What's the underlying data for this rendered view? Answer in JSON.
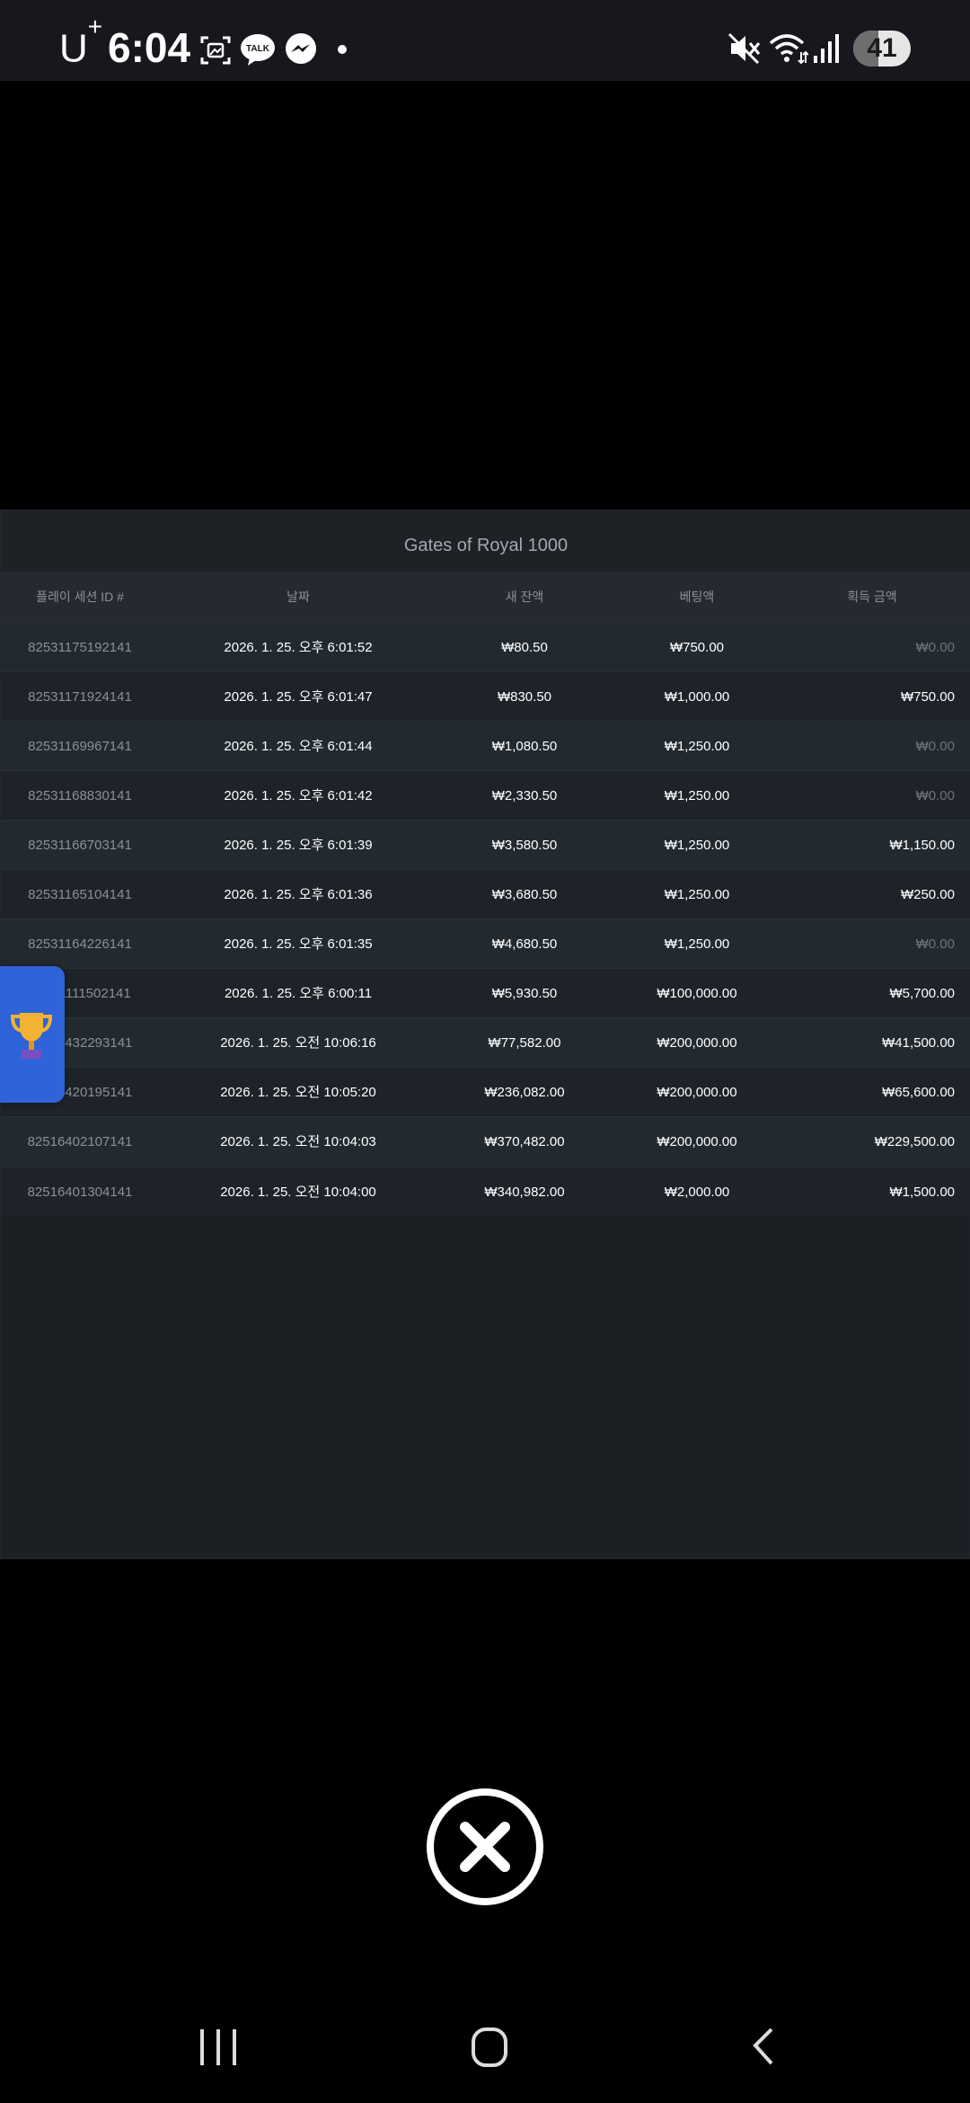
{
  "status_bar": {
    "carrier": "U",
    "carrier_sup": "+",
    "time": "6:04",
    "battery": "41",
    "icons": [
      "screenshot-icon",
      "kakaotalk-icon",
      "messenger-icon",
      "dot-icon",
      "mute-icon",
      "wifi-icon",
      "signal-icon",
      "battery-icon"
    ],
    "kakao_label": "TALK"
  },
  "panel": {
    "title": "Gates of Royal 1000",
    "columns": [
      "플레이 세션 ID #",
      "날짜",
      "새 잔액",
      "베팅액",
      "획득 금액"
    ],
    "rows": [
      {
        "id": "82531175192141",
        "date": "2026. 1. 25. 오후 6:01:52",
        "balance": "₩80.50",
        "bet": "₩750.00",
        "win": "₩0.00"
      },
      {
        "id": "82531171924141",
        "date": "2026. 1. 25. 오후 6:01:47",
        "balance": "₩830.50",
        "bet": "₩1,000.00",
        "win": "₩750.00"
      },
      {
        "id": "82531169967141",
        "date": "2026. 1. 25. 오후 6:01:44",
        "balance": "₩1,080.50",
        "bet": "₩1,250.00",
        "win": "₩0.00"
      },
      {
        "id": "82531168830141",
        "date": "2026. 1. 25. 오후 6:01:42",
        "balance": "₩2,330.50",
        "bet": "₩1,250.00",
        "win": "₩0.00"
      },
      {
        "id": "82531166703141",
        "date": "2026. 1. 25. 오후 6:01:39",
        "balance": "₩3,580.50",
        "bet": "₩1,250.00",
        "win": "₩1,150.00"
      },
      {
        "id": "82531165104141",
        "date": "2026. 1. 25. 오후 6:01:36",
        "balance": "₩3,680.50",
        "bet": "₩1,250.00",
        "win": "₩250.00"
      },
      {
        "id": "82531164226141",
        "date": "2026. 1. 25. 오후 6:01:35",
        "balance": "₩4,680.50",
        "bet": "₩1,250.00",
        "win": "₩0.00"
      },
      {
        "id": "82531111502141",
        "date": "2026. 1. 25. 오후 6:00:11",
        "balance": "₩5,930.50",
        "bet": "₩100,000.00",
        "win": "₩5,700.00"
      },
      {
        "id": "82516432293141",
        "date": "2026. 1. 25. 오전 10:06:16",
        "balance": "₩77,582.00",
        "bet": "₩200,000.00",
        "win": "₩41,500.00"
      },
      {
        "id": "82516420195141",
        "date": "2026. 1. 25. 오전 10:05:20",
        "balance": "₩236,082.00",
        "bet": "₩200,000.00",
        "win": "₩65,600.00"
      },
      {
        "id": "82516402107141",
        "date": "2026. 1. 25. 오전 10:04:03",
        "balance": "₩370,482.00",
        "bet": "₩200,000.00",
        "win": "₩229,500.00"
      },
      {
        "id": "82516401304141",
        "date": "2026. 1. 25. 오전 10:04:00",
        "balance": "₩340,982.00",
        "bet": "₩2,000.00",
        "win": "₩1,500.00"
      }
    ]
  },
  "floating": {
    "icon": "trophy-icon",
    "color": "#2f63d8"
  },
  "close": {
    "icon": "close-icon"
  },
  "nav": {
    "icons": [
      "recent-apps-icon",
      "home-icon",
      "back-icon"
    ]
  }
}
